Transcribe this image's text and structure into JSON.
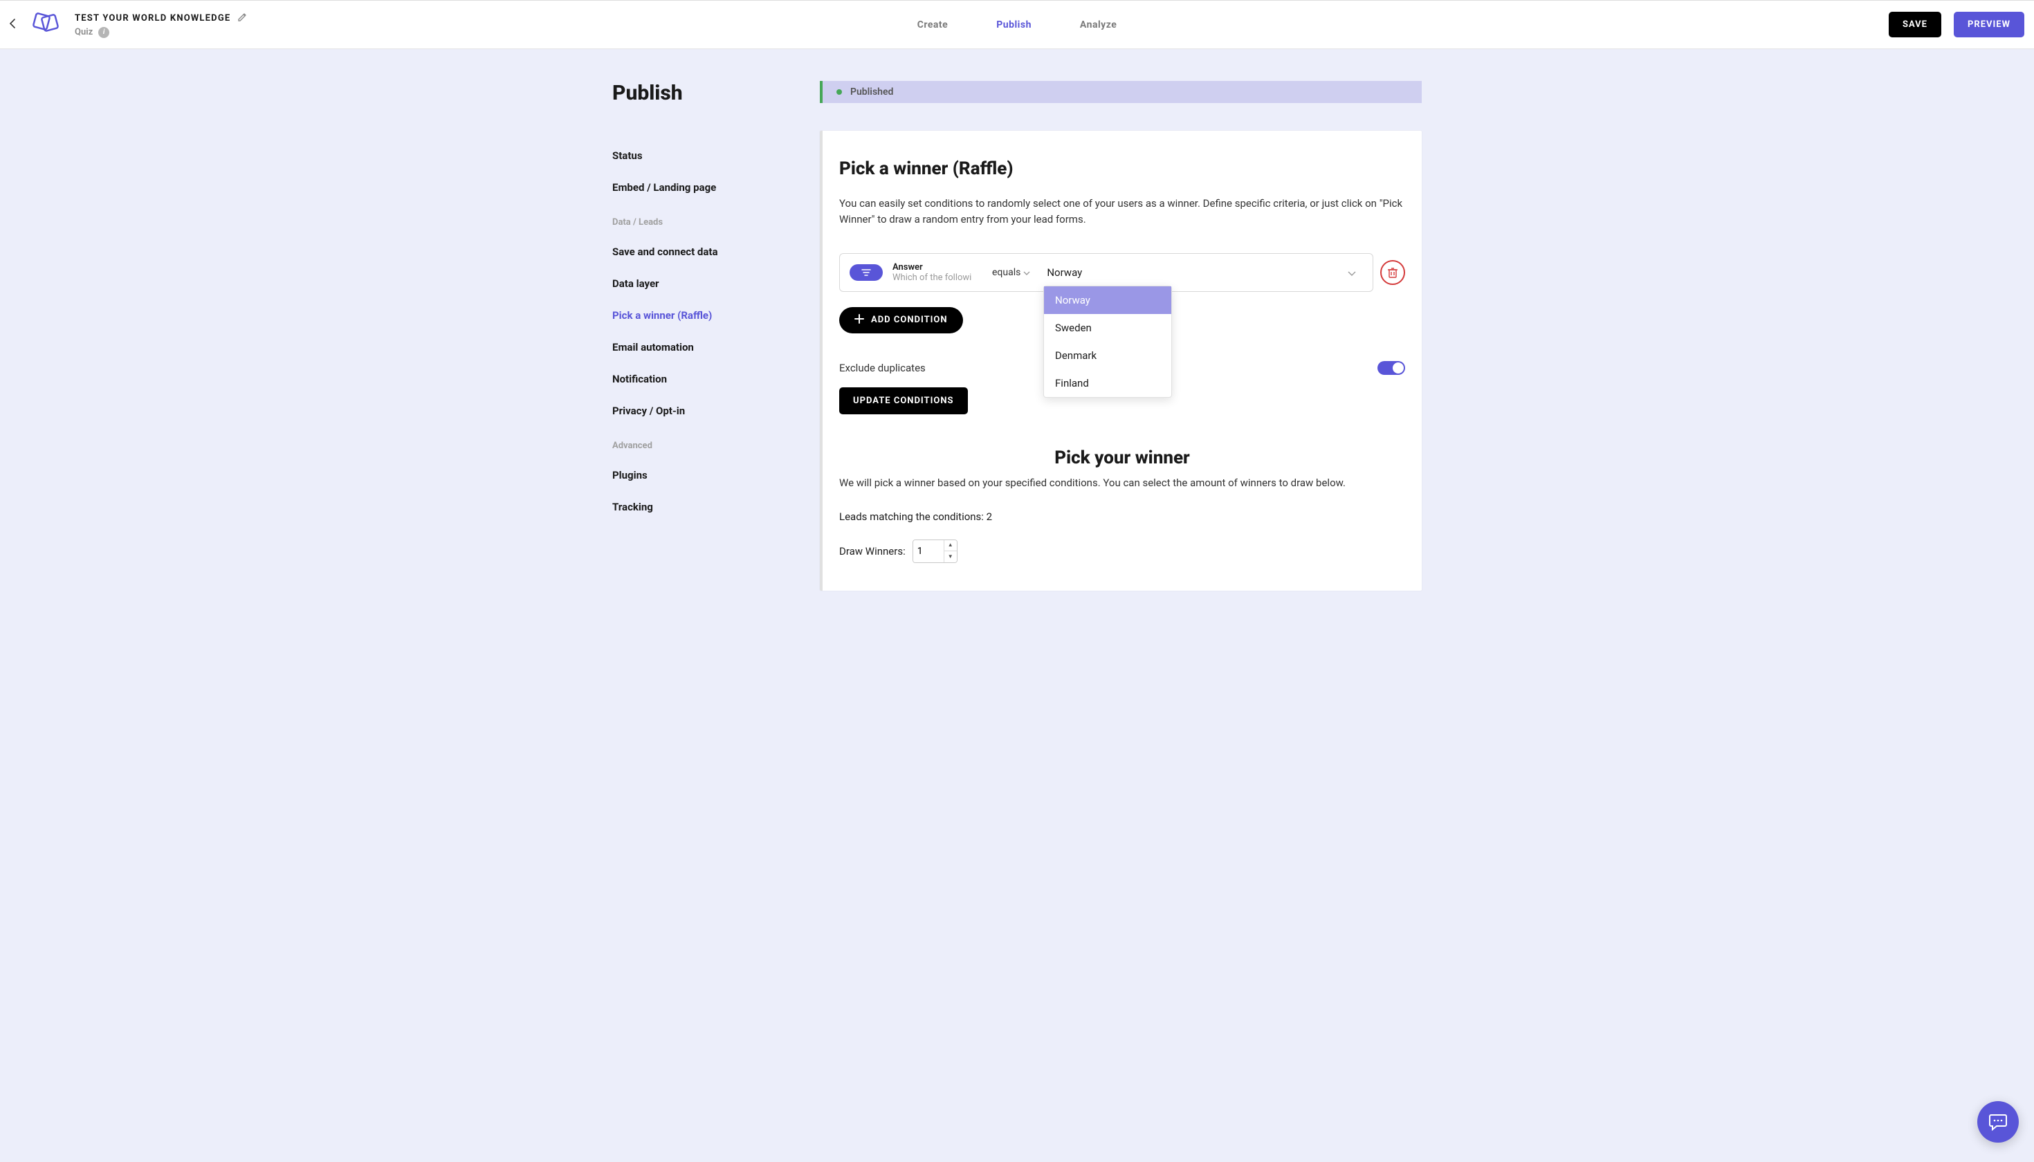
{
  "header": {
    "title": "TEST YOUR WORLD KNOWLEDGE",
    "subtitle": "Quiz"
  },
  "nav": {
    "create": "Create",
    "publish": "Publish",
    "analyze": "Analyze"
  },
  "topActions": {
    "save": "SAVE",
    "preview": "PREVIEW"
  },
  "page": {
    "title": "Publish",
    "statusLabel": "Published"
  },
  "sidebar": {
    "status": "Status",
    "embed": "Embed / Landing page",
    "sectionData": "Data / Leads",
    "saveConnect": "Save and connect data",
    "dataLayer": "Data layer",
    "pickWinner": "Pick a winner (Raffle)",
    "emailAuto": "Email automation",
    "notification": "Notification",
    "privacy": "Privacy / Opt-in",
    "sectionAdvanced": "Advanced",
    "plugins": "Plugins",
    "tracking": "Tracking"
  },
  "card": {
    "title": "Pick a winner (Raffle)",
    "desc": "You can easily set conditions to randomly select one of your users as a winner. Define specific criteria, or just click on \"Pick Winner\" to draw a random entry from your lead forms.",
    "answerLabel": "Answer",
    "answerSub": "Which of the followi",
    "equals": "equals",
    "selectedValue": "Norway",
    "addCondition": "ADD CONDITION",
    "excludeDuplicates": "Exclude duplicates",
    "updateConditions": "UPDATE CONDITIONS",
    "pickTitle": "Pick your winner",
    "pickDesc": "We will pick a winner based on your specified conditions. You can select the amount of winners to draw below.",
    "leadsPrefix": "Leads matching the conditions: ",
    "leadsCount": "2",
    "drawLabel": "Draw Winners:",
    "drawValue": "1"
  },
  "dropdown": {
    "options": [
      "Norway",
      "Sweden",
      "Denmark",
      "Finland"
    ]
  }
}
